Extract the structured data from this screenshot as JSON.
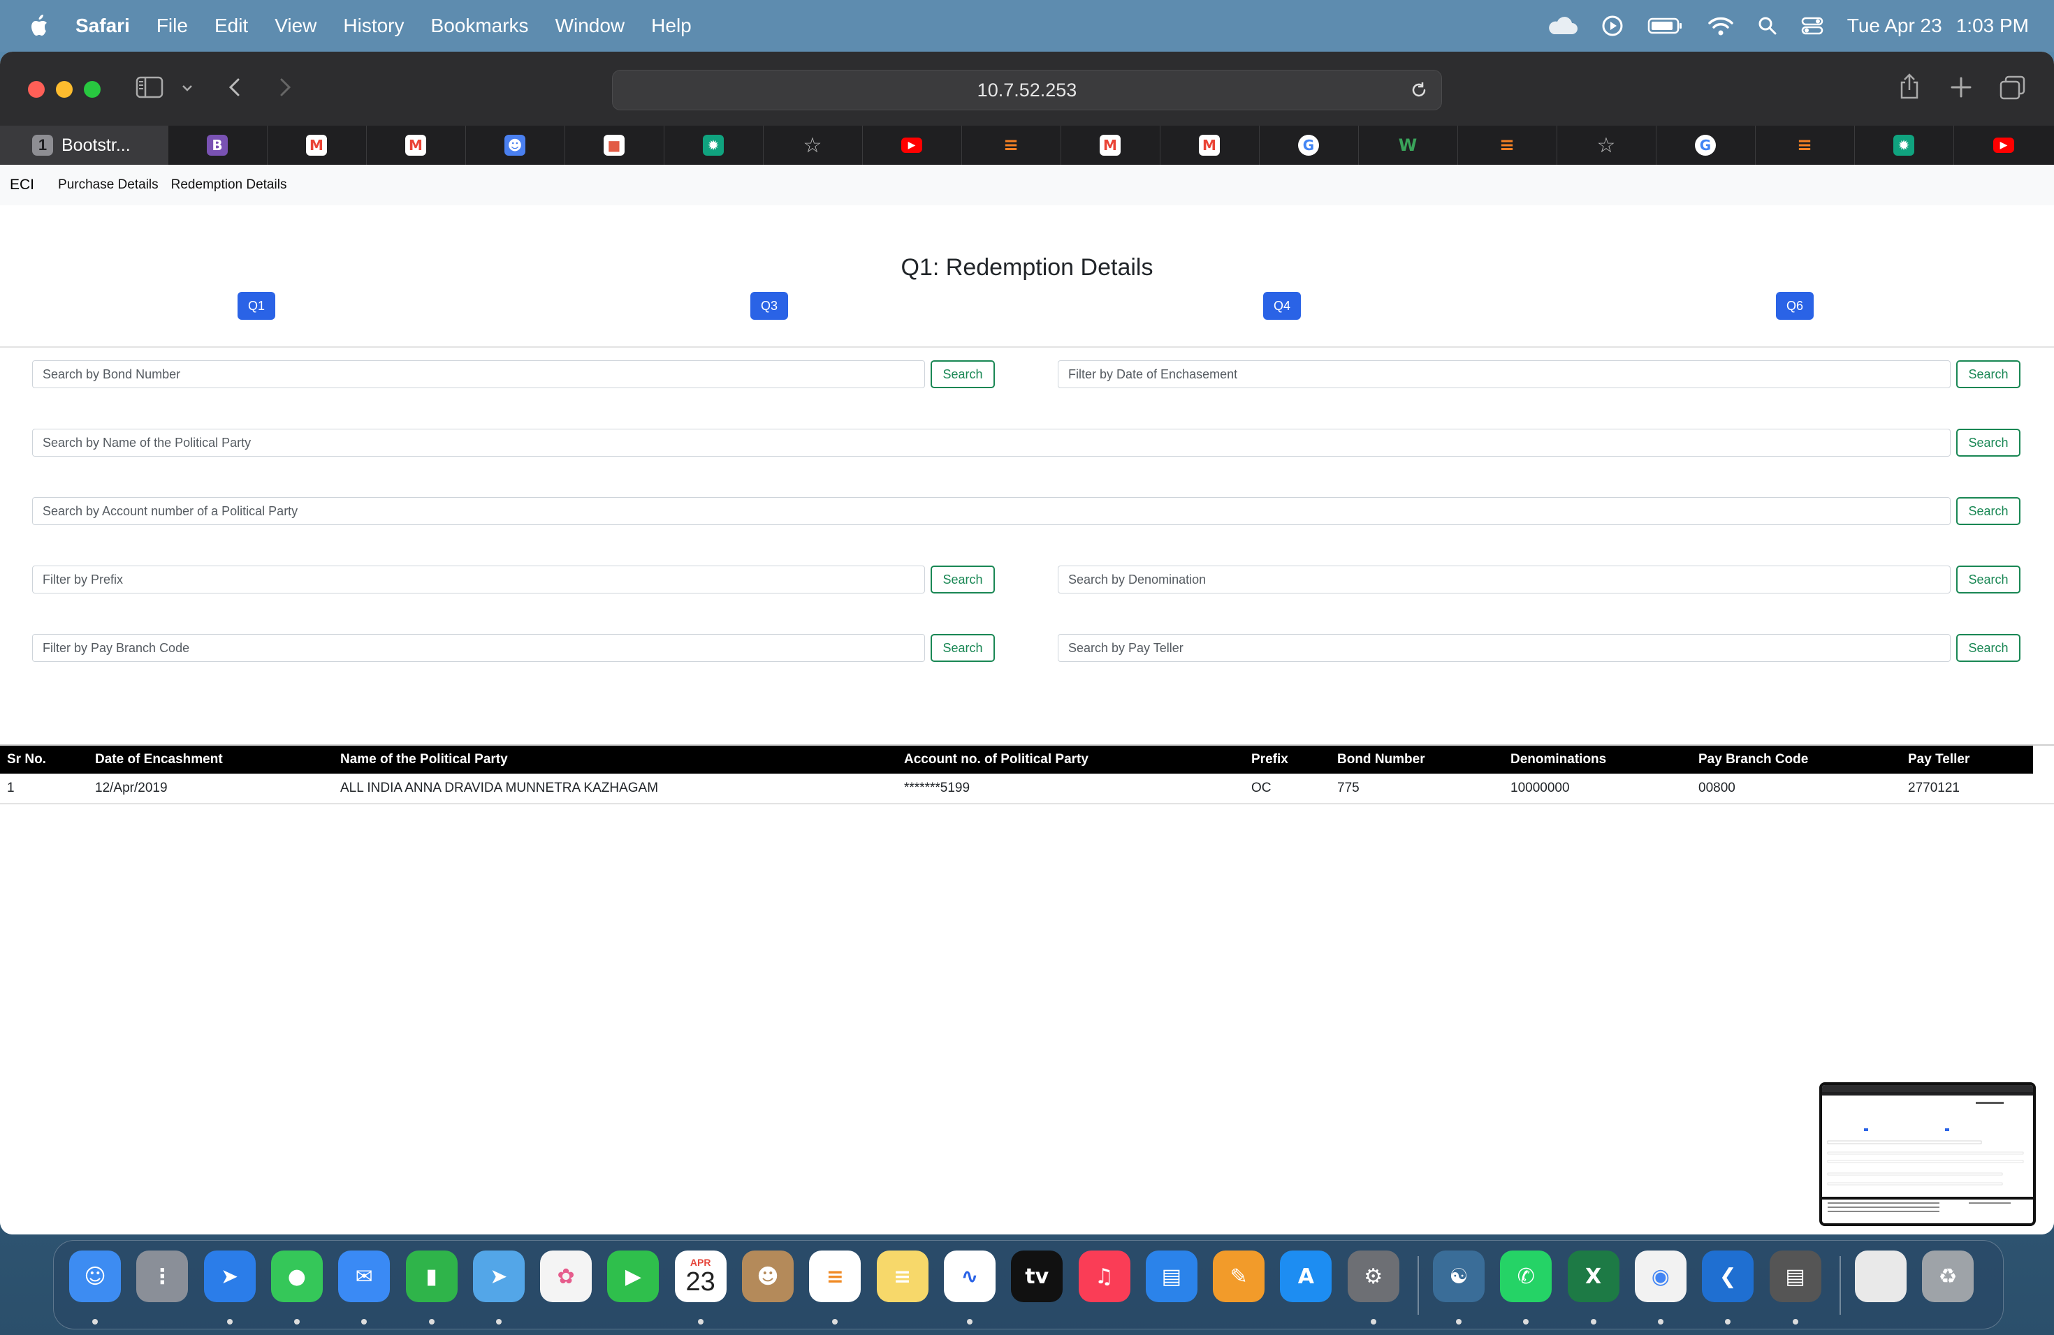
{
  "menubar": {
    "app": "Safari",
    "items": [
      "File",
      "Edit",
      "View",
      "History",
      "Bookmarks",
      "Window",
      "Help"
    ],
    "date": "Tue Apr 23",
    "time": "1:03 PM"
  },
  "browser": {
    "url": "10.7.52.253",
    "active_tab": {
      "number": "1",
      "title": "Bootstr..."
    },
    "favorites": [
      "bootstrap",
      "gmail",
      "gmail",
      "contacts",
      "box",
      "chatgpt",
      "star",
      "youtube",
      "stackoverflow",
      "gmail",
      "gmail",
      "google",
      "wikidata",
      "stackoverflow",
      "star",
      "google",
      "stackoverflow",
      "chatgpt",
      "youtube"
    ]
  },
  "nav": {
    "brand": "ECI",
    "links": [
      "Purchase Details",
      "Redemption Details"
    ]
  },
  "page": {
    "title": "Q1: Redemption Details",
    "query_buttons": [
      "Q1",
      "Q3",
      "Q4",
      "Q6"
    ]
  },
  "filters": {
    "bond_number": "Search by Bond Number",
    "date_encashment": "Filter by Date of Enchasement",
    "party_name": "Search by Name of the Political Party",
    "account_number": "Search by Account number of a Political Party",
    "prefix": "Filter by Prefix",
    "denomination": "Search by Denomination",
    "pay_branch_code": "Filter by Pay Branch Code",
    "pay_teller": "Search by Pay Teller",
    "button_label": "Search"
  },
  "table": {
    "headers": [
      "Sr No.",
      "Date of Encashment",
      "Name of the Political Party",
      "Account no. of Political Party",
      "Prefix",
      "Bond Number",
      "Denominations",
      "Pay Branch Code",
      "Pay Teller"
    ],
    "rows": [
      [
        "1",
        "12/Apr/2019",
        "ALL INDIA ANNA DRAVIDA MUNNETRA KAZHAGAM",
        "*******5199",
        "OC",
        "775",
        "10000000",
        "00800",
        "2770121"
      ]
    ]
  },
  "dock": {
    "calendar_month": "APR",
    "calendar_day": "23",
    "apps": [
      "Finder",
      "Launchpad",
      "Safari",
      "Messages",
      "Mail",
      "Numbers",
      "Maps",
      "Photos",
      "FaceTime",
      "Calendar",
      "Contacts",
      "Reminders",
      "Notes",
      "Freeform",
      "Apple TV",
      "Music",
      "Keynote",
      "Pages",
      "App Store",
      "System Settings",
      "MySQL Workbench",
      "WhatsApp",
      "Excel",
      "Chrome",
      "VS Code",
      "Calculator",
      "Document",
      "Trash"
    ]
  }
}
